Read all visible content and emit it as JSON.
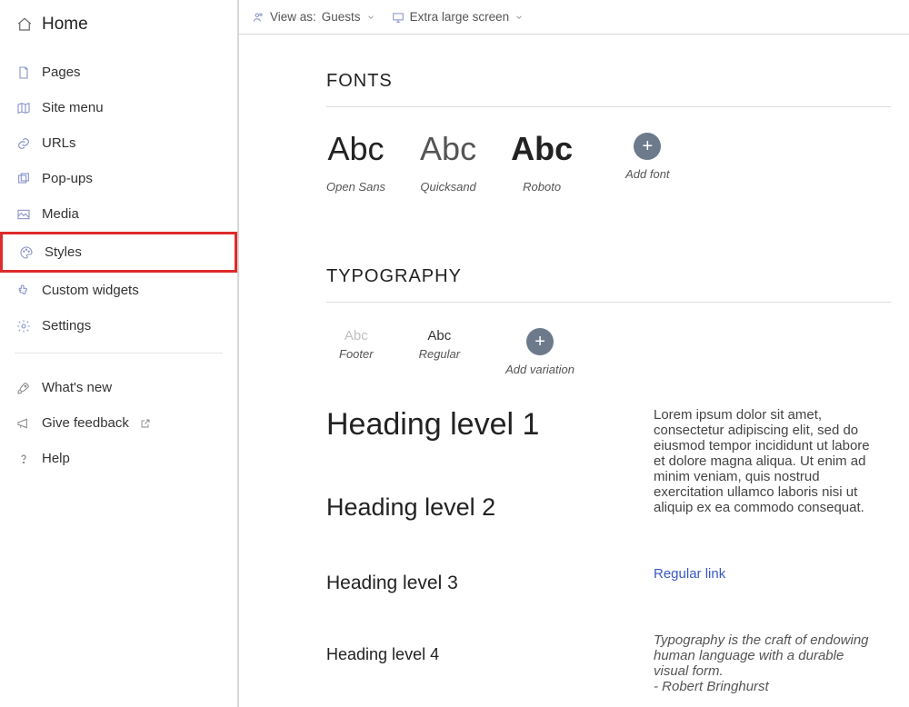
{
  "sidebar": {
    "title": "Home",
    "items": [
      {
        "label": "Pages"
      },
      {
        "label": "Site menu"
      },
      {
        "label": "URLs"
      },
      {
        "label": "Pop-ups"
      },
      {
        "label": "Media"
      },
      {
        "label": "Styles"
      },
      {
        "label": "Custom widgets"
      },
      {
        "label": "Settings"
      }
    ],
    "footer": [
      {
        "label": "What's new"
      },
      {
        "label": "Give feedback"
      },
      {
        "label": "Help"
      }
    ]
  },
  "topbar": {
    "view_as_prefix": "View as:",
    "view_as_value": "Guests",
    "screen_value": "Extra large screen"
  },
  "fonts": {
    "heading": "FONTS",
    "sample": "Abc",
    "list": [
      {
        "name": "Open Sans"
      },
      {
        "name": "Quicksand"
      },
      {
        "name": "Roboto"
      }
    ],
    "add_label": "Add font"
  },
  "typography": {
    "heading": "TYPOGRAPHY",
    "sample": "Abc",
    "variations": [
      {
        "name": "Footer",
        "dim": true
      },
      {
        "name": "Regular",
        "dim": false
      }
    ],
    "add_label": "Add variation",
    "headings": [
      "Heading level 1",
      "Heading level 2",
      "Heading level 3",
      "Heading level 4"
    ],
    "lorem": "Lorem ipsum dolor sit amet, consectetur adipiscing elit, sed do eiusmod tempor incididunt ut labore et dolore magna aliqua. Ut enim ad minim veniam, quis nostrud exercitation ullamco laboris nisi ut aliquip ex ea commodo consequat.",
    "link_text": "Regular link",
    "quote": "Typography is the craft of endowing human language with a durable visual form.\n- Robert Bringhurst"
  }
}
